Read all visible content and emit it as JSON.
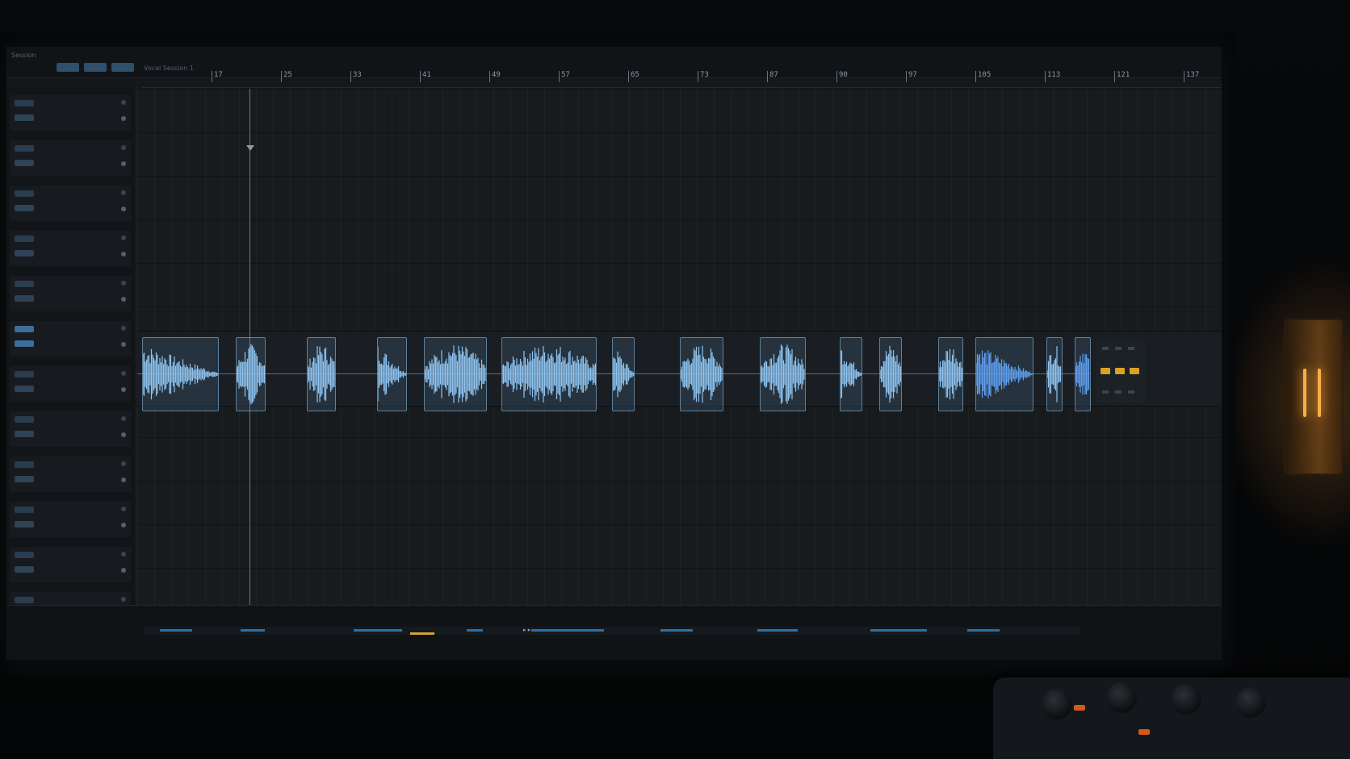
{
  "app": {
    "title": "Session",
    "session_name": "Vocal Session 1",
    "toolbar_buttons": [
      "",
      "",
      ""
    ]
  },
  "ruler": {
    "bars": [
      "17",
      "25",
      "33",
      "41",
      "49",
      "57",
      "65",
      "73",
      "87",
      "90",
      "97",
      "105",
      "113",
      "121",
      "137"
    ]
  },
  "tracks": {
    "count": 12,
    "selected_index": 5
  },
  "clips": {
    "count": 15,
    "color": "#8fc4ef",
    "selected_color": "#5f9ff0"
  },
  "overview": {
    "label": "▸ ▸"
  },
  "colors": {
    "accent": "#5f9ff0",
    "yellow": "#d9a125",
    "orange": "#d4571e",
    "background": "#15181b"
  },
  "icons": [
    "playhead-marker-icon",
    "mute-led-icon",
    "record-led-icon"
  ]
}
